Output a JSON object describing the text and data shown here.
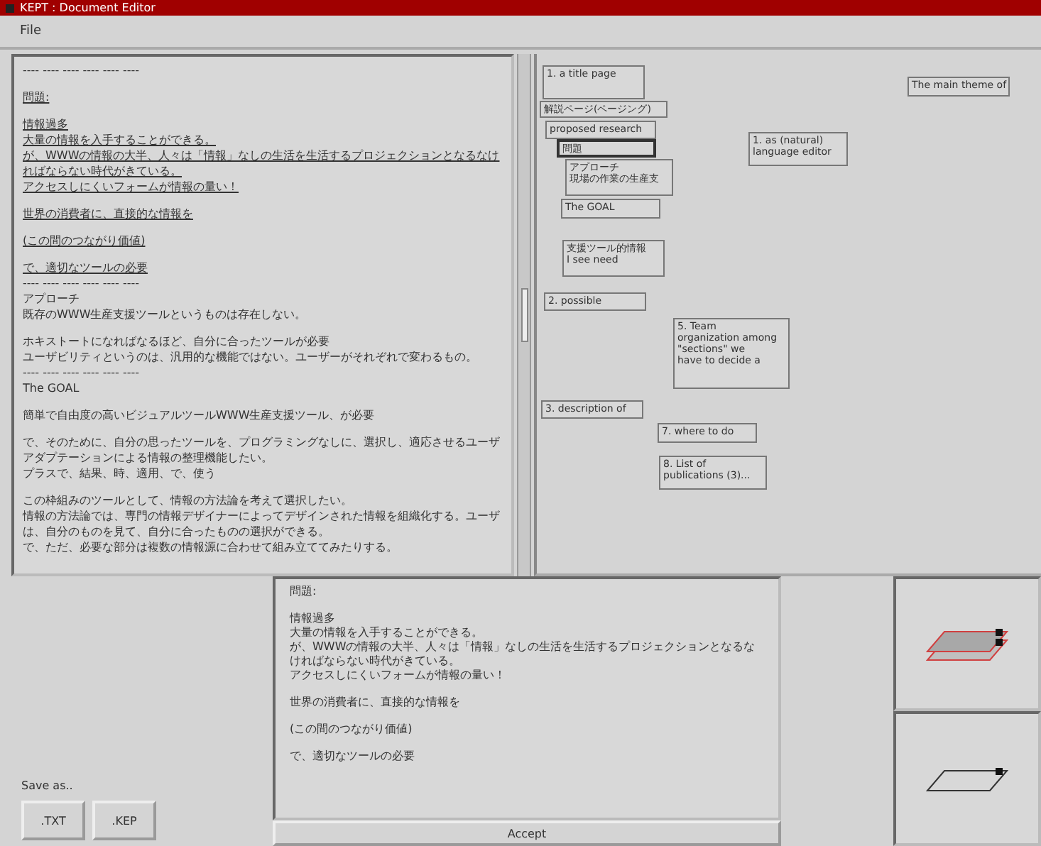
{
  "window": {
    "title": "KEPT : Document Editor"
  },
  "menu": [
    "File"
  ],
  "document": {
    "paragraphs": [
      {
        "lines": [
          {
            "text": "---- ---- ---- ---- ---- ----",
            "underlined": false
          }
        ]
      },
      {
        "lines": [
          {
            "text": "問題:",
            "underlined": true
          }
        ]
      },
      {
        "lines": [
          {
            "text": "情報過多",
            "underlined": true
          },
          {
            "text": "大量の情報を入手することができる。",
            "underlined": true
          },
          {
            "text": "が、WWWの情報の大半、人々は「情報」なしの生活を生活するプロジェクションとなるなければならない時代がきている。",
            "underlined": true
          },
          {
            "text": "アクセスしにくいフォームが情報の量い！",
            "underlined": true
          }
        ]
      },
      {
        "lines": [
          {
            "text": "世界の消費者に、直接的な情報を",
            "underlined": true
          }
        ]
      },
      {
        "lines": [
          {
            "text": "(この間のつながり価値)",
            "underlined": true
          }
        ]
      },
      {
        "lines": [
          {
            "text": "で、適切なツールの必要",
            "underlined": true
          },
          {
            "text": "---- ---- ---- ---- ---- ----",
            "underlined": false
          },
          {
            "text": "アプローチ",
            "underlined": false
          },
          {
            "text": "既存のWWW生産支援ツールというものは存在しない。",
            "underlined": false
          }
        ]
      },
      {
        "lines": [
          {
            "text": "ホキストートになればなるほど、自分に合ったツールが必要",
            "underlined": false
          },
          {
            "text": "ユーザビリティというのは、汎用的な機能ではない。ユーザーがそれぞれで変わるもの。",
            "underlined": false
          },
          {
            "text": "---- ---- ---- ---- ---- ----",
            "underlined": false
          },
          {
            "text": "The GOAL",
            "underlined": false
          }
        ]
      },
      {
        "lines": [
          {
            "text": "簡単で自由度の高いビジュアルツールWWW生産支援ツール、が必要",
            "underlined": false
          }
        ]
      },
      {
        "lines": [
          {
            "text": "で、そのために、自分の思ったツールを、プログラミングなしに、選択し、適応させるユーザアダプテーションによる情報の整理機能したい。",
            "underlined": false
          },
          {
            "text": "プラスで、結果、時、適用、で、使う",
            "underlined": false
          }
        ]
      },
      {
        "lines": [
          {
            "text": "この枠組みのツールとして、情報の方法論を考えて選択したい。",
            "underlined": false
          },
          {
            "text": "情報の方法論では、専門の情報デザイナーによってデザインされた情報を組織化する。ユーザは、自分のものを見て、自分に合ったものの選択ができる。",
            "underlined": false
          },
          {
            "text": "で、ただ、必要な部分は複数の情報源に合わせて組み立ててみたりする。",
            "underlined": false
          }
        ]
      }
    ]
  },
  "canvas": {
    "nodes": [
      {
        "lines": [
          "1. a title page"
        ],
        "selected": false
      },
      {
        "lines": [
          "解説ページ(ページング)"
        ],
        "selected": false
      },
      {
        "lines": [
          "proposed research"
        ],
        "selected": false
      },
      {
        "lines": [
          "問題"
        ],
        "selected": true
      },
      {
        "lines": [
          "アプローチ",
          "現場の作業の生産支"
        ],
        "selected": false
      },
      {
        "lines": [
          "The GOAL"
        ],
        "selected": false
      },
      {
        "lines": [
          "支援ツール的情報",
          "I see need"
        ],
        "selected": false
      },
      {
        "lines": [
          "2. possible"
        ],
        "selected": false
      },
      {
        "lines": [
          "5. Team",
          "organization among",
          "\"sections\"  we",
          "have to decide a"
        ],
        "selected": false
      },
      {
        "lines": [
          "3. description of"
        ],
        "selected": false
      },
      {
        "lines": [
          "7. where to do"
        ],
        "selected": false
      },
      {
        "lines": [
          "8. List of",
          "publications (3)..."
        ],
        "selected": false
      },
      {
        "lines": [
          "The main theme of"
        ],
        "selected": false
      },
      {
        "lines": [
          "1. as (natural)",
          "language editor"
        ],
        "selected": false
      }
    ]
  },
  "editor": {
    "paragraphs": [
      {
        "lines": [
          "問題:"
        ]
      },
      {
        "lines": [
          "情報過多",
          "大量の情報を入手することができる。",
          "が、WWWの情報の大半、人々は「情報」なしの生活を生活するプロジェクションとなるなければならない時代がきている。",
          "アクセスしにくいフォームが情報の量い！"
        ]
      },
      {
        "lines": [
          "世界の消費者に、直接的な情報を"
        ]
      },
      {
        "lines": [
          "(この間のつながり価値)"
        ]
      },
      {
        "lines": [
          "で、適切なツールの必要"
        ]
      }
    ],
    "accept_button": "Accept"
  },
  "save": {
    "label": "Save as..",
    "buttons": [
      ".TXT",
      ".KEP"
    ]
  },
  "previews": [
    {
      "selected": true
    },
    {
      "selected": false
    }
  ]
}
